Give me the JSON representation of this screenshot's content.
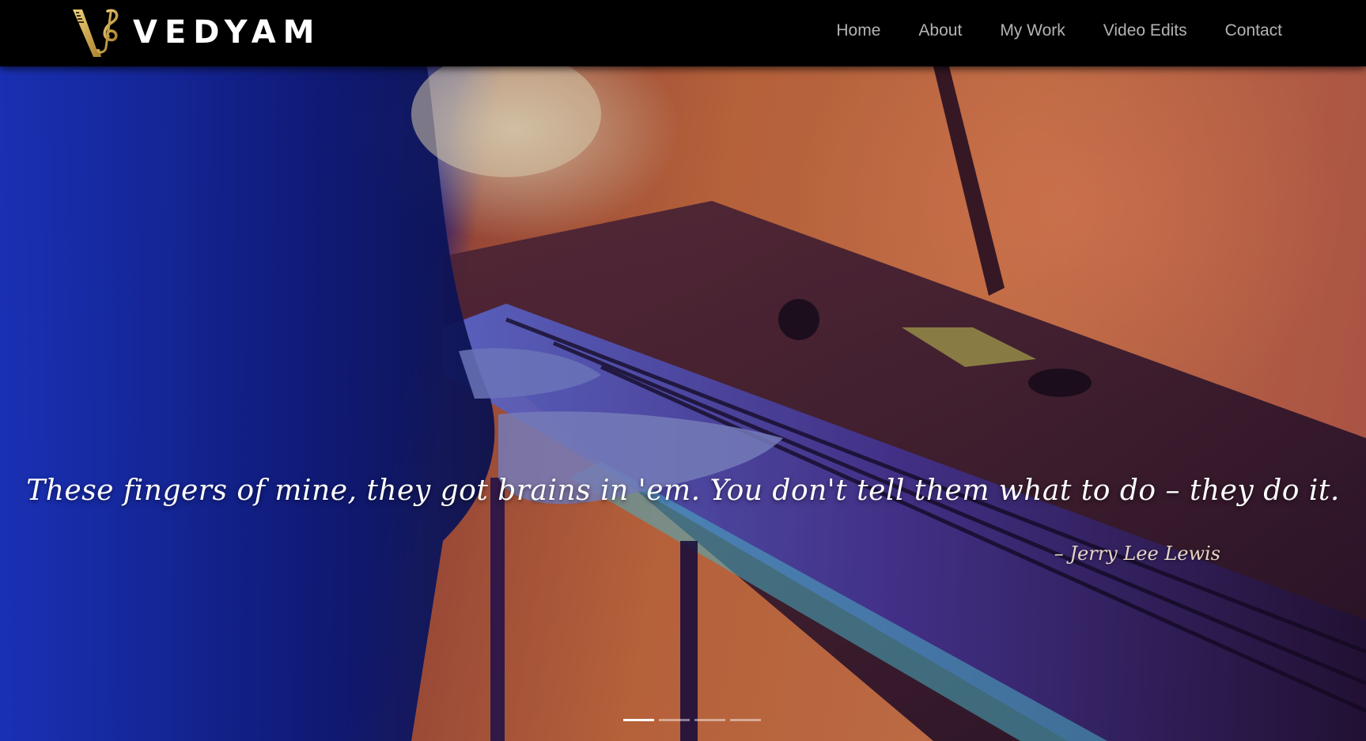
{
  "brand": {
    "name": "VEDYAM",
    "logo_icon": "v-treble-clef-logo-icon",
    "logo_color": "#c9a24a"
  },
  "nav": {
    "items": [
      {
        "label": "Home"
      },
      {
        "label": "About"
      },
      {
        "label": "My Work"
      },
      {
        "label": "Video Edits"
      },
      {
        "label": "Contact"
      }
    ]
  },
  "hero": {
    "quote": "These fingers of mine, they got brains in 'em. You don't tell them what to do – they do it.",
    "author": "– Jerry Lee Lewis",
    "slides_count": 4,
    "active_slide": 1
  }
}
